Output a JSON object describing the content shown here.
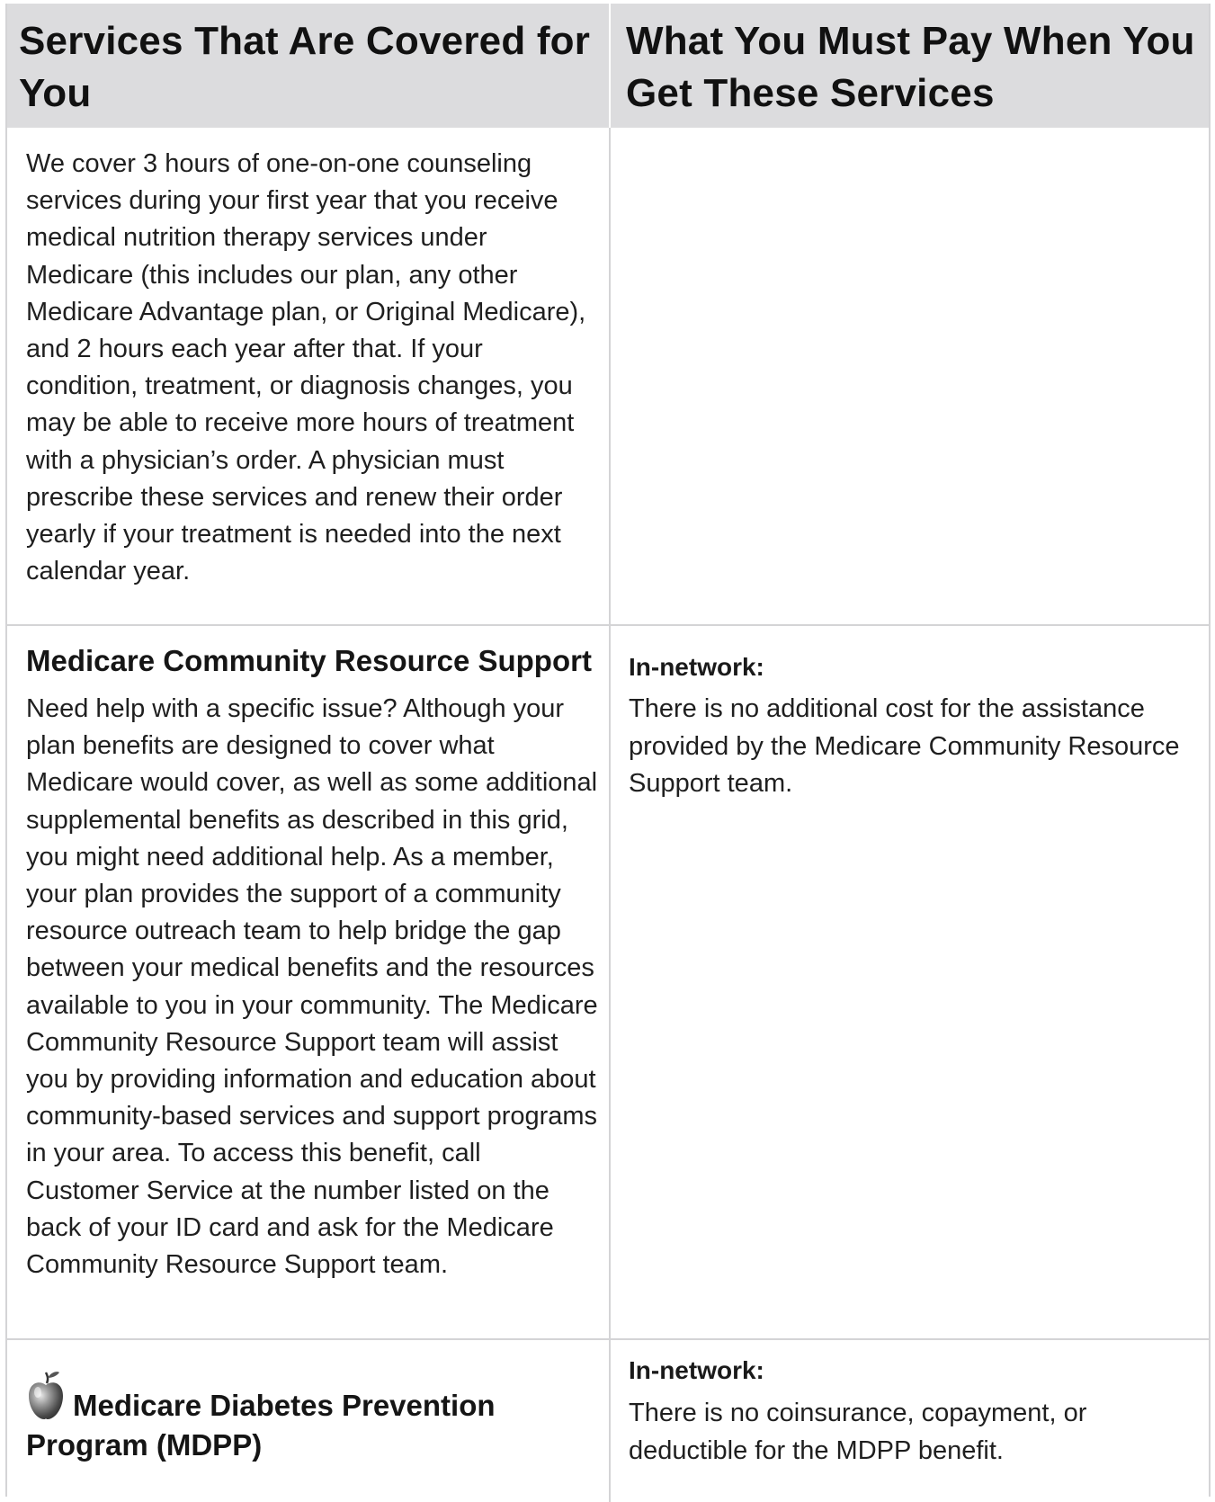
{
  "header": {
    "left": "Services That Are Covered for You",
    "right": "What You Must Pay When You Get These Services"
  },
  "rows": [
    {
      "left_text": "We cover 3 hours of one-on-one counseling services during your first year that you receive medical nutrition therapy services under Medicare (this includes our plan, any other Medicare Advantage plan, or Original Medicare), and 2 hours each year after that. If your condition, treatment, or diagnosis changes, you may be able to receive more hours of treatment with a physician’s order. A physician must prescribe these services and renew their order yearly if your treatment is needed into the next calendar year."
    },
    {
      "title": "Medicare Community Resource Support",
      "left_text": "Need help with a specific issue?  Although your plan benefits are designed to cover what Medicare would cover, as well as some additional supplemental benefits as described in this grid, you might need additional help. As a member, your plan provides the support of a community resource outreach team to help bridge the gap between your medical benefits and the resources available to you in your community. The Medicare Community Resource Support team will assist you by providing information and education about community-based services and support programs in your area. To access this benefit, call Customer Service at the number listed on the back of your ID card and ask for the Medicare Community Resource Support team.",
      "right_label": "In-network:",
      "right_text": "There is no additional cost for the assistance provided by the Medicare Community Resource Support team."
    },
    {
      "title": "Medicare Diabetes Prevention Program (MDPP)",
      "icon": "apple-icon",
      "right_label": "In-network:",
      "right_text": "There is no coinsurance, copayment, or deductible for the MDPP benefit."
    }
  ],
  "colors": {
    "header_bg": "#dcdcde",
    "border": "#d4d4d6",
    "text": "#1f1f1f"
  }
}
